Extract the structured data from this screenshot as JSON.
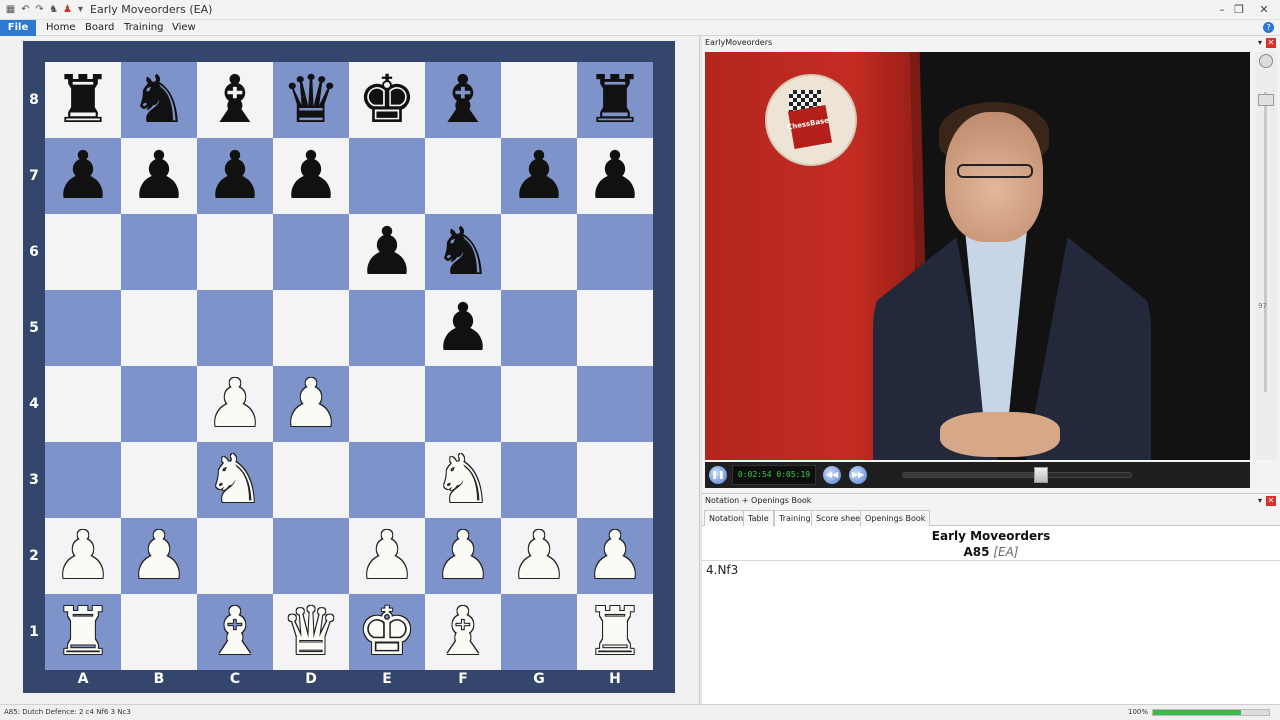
{
  "app": {
    "title": "Early Moveorders  (EA)",
    "quick_access_icons": [
      "app-icon",
      "undo-icon",
      "redo-icon",
      "piece-icon",
      "tool-icon",
      "dropdown-icon"
    ],
    "window_controls": {
      "minimize": "–",
      "restore": "❐",
      "close": "✕"
    }
  },
  "ribbon": {
    "file": "File",
    "menus": [
      "Home",
      "Board",
      "Training",
      "View"
    ],
    "help": "?"
  },
  "board": {
    "ranks": [
      "8",
      "7",
      "6",
      "5",
      "4",
      "3",
      "2",
      "1"
    ],
    "files": [
      "A",
      "B",
      "C",
      "D",
      "E",
      "F",
      "G",
      "H"
    ],
    "position": [
      [
        "r",
        "n",
        "b",
        "q",
        "k",
        "b",
        "",
        "r"
      ],
      [
        "p",
        "p",
        "p",
        "p",
        "",
        "",
        "p",
        "p"
      ],
      [
        "",
        "",
        "",
        "",
        "p",
        "n",
        "",
        ""
      ],
      [
        "",
        "",
        "",
        "",
        "",
        "p",
        "",
        ""
      ],
      [
        "",
        "",
        "P",
        "P",
        "",
        "",
        "",
        ""
      ],
      [
        "",
        "",
        "N",
        "",
        "",
        "N",
        "",
        ""
      ],
      [
        "P",
        "P",
        "",
        "",
        "P",
        "P",
        "P",
        "P"
      ],
      [
        "R",
        "",
        "B",
        "Q",
        "K",
        "B",
        "",
        "R"
      ]
    ],
    "colors": {
      "light": "#f4f4f6",
      "dark": "#7d93c9",
      "frame": "#34466b"
    }
  },
  "video_pane": {
    "title": "EarlyMoveorders",
    "logo_text": "ChessBase",
    "time": "0:02:54  0:05:19",
    "progress": 0.6,
    "volume_label": "97"
  },
  "notation_pane": {
    "title": "Notation + Openings Book",
    "tabs": [
      "Notation",
      "Table",
      "Training",
      "Score sheet",
      "Openings Book"
    ],
    "active_tab": 2,
    "game_title": "Early Moveorders",
    "eco": "A85",
    "tag": "[EA]",
    "moves": "4.Nf3"
  },
  "status": {
    "text": "A85: Dutch Defence: 2 c4 Nf6 3 Nc3",
    "zoom": "100%",
    "progress": 0.76,
    "accent": "#3cba4a"
  }
}
